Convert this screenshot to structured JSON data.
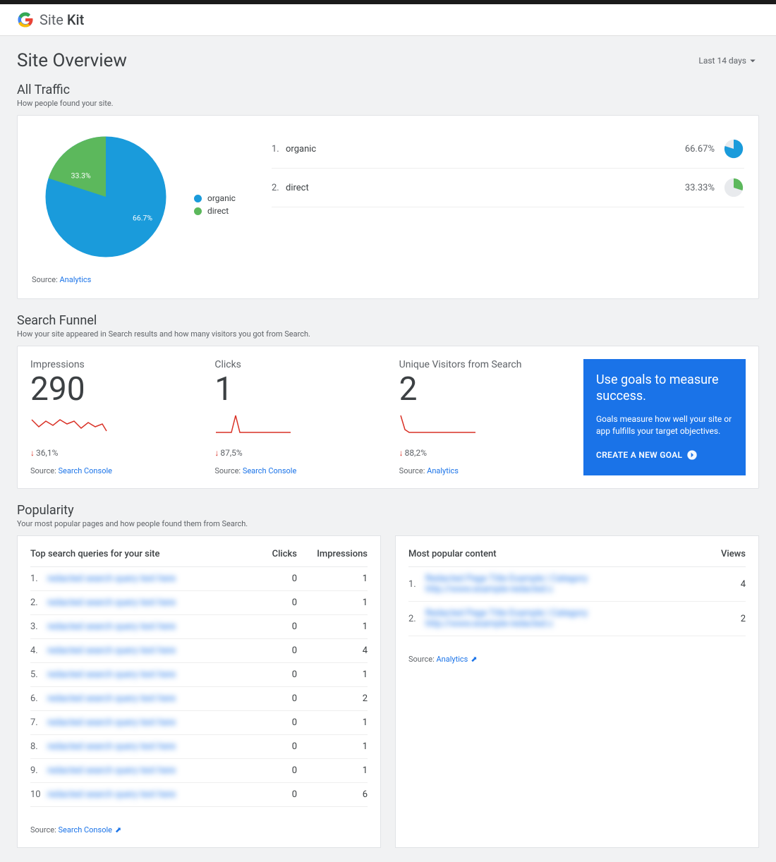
{
  "header": {
    "product": "Site",
    "product_bold": "Kit"
  },
  "page": {
    "title": "Site Overview",
    "period": "Last 14 days"
  },
  "traffic": {
    "title": "All Traffic",
    "sub": "How people found your site.",
    "legend": {
      "organic": "organic",
      "direct": "direct"
    },
    "labels": {
      "slice1": "66.7%",
      "slice2": "33.3%"
    },
    "rows": [
      {
        "n": "1.",
        "label": "organic",
        "pct": "66.67%"
      },
      {
        "n": "2.",
        "label": "direct",
        "pct": "33.33%"
      }
    ],
    "source_label": "Source:",
    "source_link": "Analytics"
  },
  "funnel": {
    "title": "Search Funnel",
    "sub": "How your site appeared in Search results and how many visitors you got from Search.",
    "cols": [
      {
        "label": "Impressions",
        "value": "290",
        "delta": "36,1%",
        "source": "Search Console"
      },
      {
        "label": "Clicks",
        "value": "1",
        "delta": "87,5%",
        "source": "Search Console"
      },
      {
        "label": "Unique Visitors from Search",
        "value": "2",
        "delta": "88,2%",
        "source": "Analytics"
      }
    ],
    "source_label": "Source:",
    "goal": {
      "title": "Use goals to measure success.",
      "desc": "Goals measure how well your site or app fulfills your target objectives.",
      "cta": "CREATE A NEW GOAL"
    }
  },
  "popularity": {
    "title": "Popularity",
    "sub": "Your most popular pages and how people found them from Search.",
    "queries": {
      "heading": "Top search queries for your site",
      "col_clicks": "Clicks",
      "col_impr": "Impressions",
      "rows": [
        {
          "n": "1.",
          "clicks": "0",
          "impr": "1"
        },
        {
          "n": "2.",
          "clicks": "0",
          "impr": "1"
        },
        {
          "n": "3.",
          "clicks": "0",
          "impr": "1"
        },
        {
          "n": "4.",
          "clicks": "0",
          "impr": "4"
        },
        {
          "n": "5.",
          "clicks": "0",
          "impr": "1"
        },
        {
          "n": "6.",
          "clicks": "0",
          "impr": "2"
        },
        {
          "n": "7.",
          "clicks": "0",
          "impr": "1"
        },
        {
          "n": "8.",
          "clicks": "0",
          "impr": "1"
        },
        {
          "n": "9.",
          "clicks": "0",
          "impr": "1"
        },
        {
          "n": "10",
          "clicks": "0",
          "impr": "6"
        }
      ],
      "source_label": "Source:",
      "source_link": "Search Console"
    },
    "content": {
      "heading": "Most popular content",
      "col_views": "Views",
      "rows": [
        {
          "n": "1.",
          "views": "4"
        },
        {
          "n": "2.",
          "views": "2"
        }
      ],
      "source_label": "Source:",
      "source_link": "Analytics"
    }
  },
  "chart_data": {
    "type": "pie",
    "title": "All Traffic",
    "series": [
      {
        "name": "organic",
        "value": 66.67,
        "color": "#1a9bdb"
      },
      {
        "name": "direct",
        "value": 33.33,
        "color": "#5cb85c"
      }
    ]
  }
}
